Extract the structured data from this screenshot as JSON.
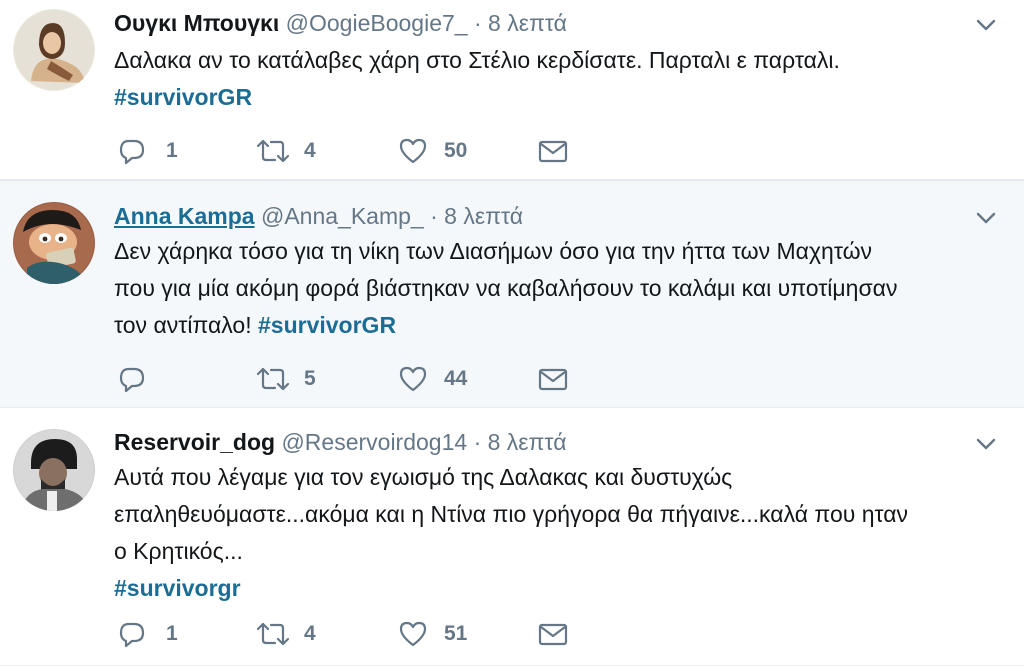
{
  "tweets": [
    {
      "name": "Ουγκι Μπουγκι",
      "handle": "@OogieBoogie7_",
      "separator": "·",
      "time": "8 λεπτά",
      "lines": [
        "Δαλακα αν το κατάλαβες χάρη στο Στέλιο κερδίσατε. Παρταλι ε παρταλι."
      ],
      "hashtag": "#survivorGR",
      "replies": "1",
      "retweets": "4",
      "likes": "50"
    },
    {
      "name": "Anna Kampa",
      "handle": "@Anna_Kamp_",
      "separator": "·",
      "time": "8 λεπτά",
      "lines": [
        "Δεν χάρηκα τόσο για τη νίκη των Διασήμων όσο για την ήττα των Μαχητών",
        "που για μία ακόμη φορά βιάστηκαν να καβαλήσουν το καλάμι και υποτίμησαν",
        "τον αντίπαλο! "
      ],
      "hashtag": "#survivorGR",
      "replies": "",
      "retweets": "5",
      "likes": "44"
    },
    {
      "name": "Reservoir_dog",
      "handle": "@Reservoirdog14",
      "separator": "·",
      "time": "8 λεπτά",
      "lines": [
        "Αυτά που λέγαμε για τον εγωισμό της Δαλακας και δυστυχώς",
        "επαληθευόμαστε...ακόμα και η Ντίνα πιο γρήγορα θα πήγαινε...καλά που ηταν",
        "ο Κρητικός..."
      ],
      "hashtag": "#survivorgr",
      "replies": "1",
      "retweets": "4",
      "likes": "51"
    }
  ],
  "colors": {
    "link": "#1b6d95",
    "muted": "#657786",
    "text": "#14171a",
    "highlight_bg": "#f5f8fa"
  },
  "icons": [
    "reply-icon",
    "retweet-icon",
    "like-icon",
    "direct-message-icon",
    "chevron-down-icon"
  ]
}
